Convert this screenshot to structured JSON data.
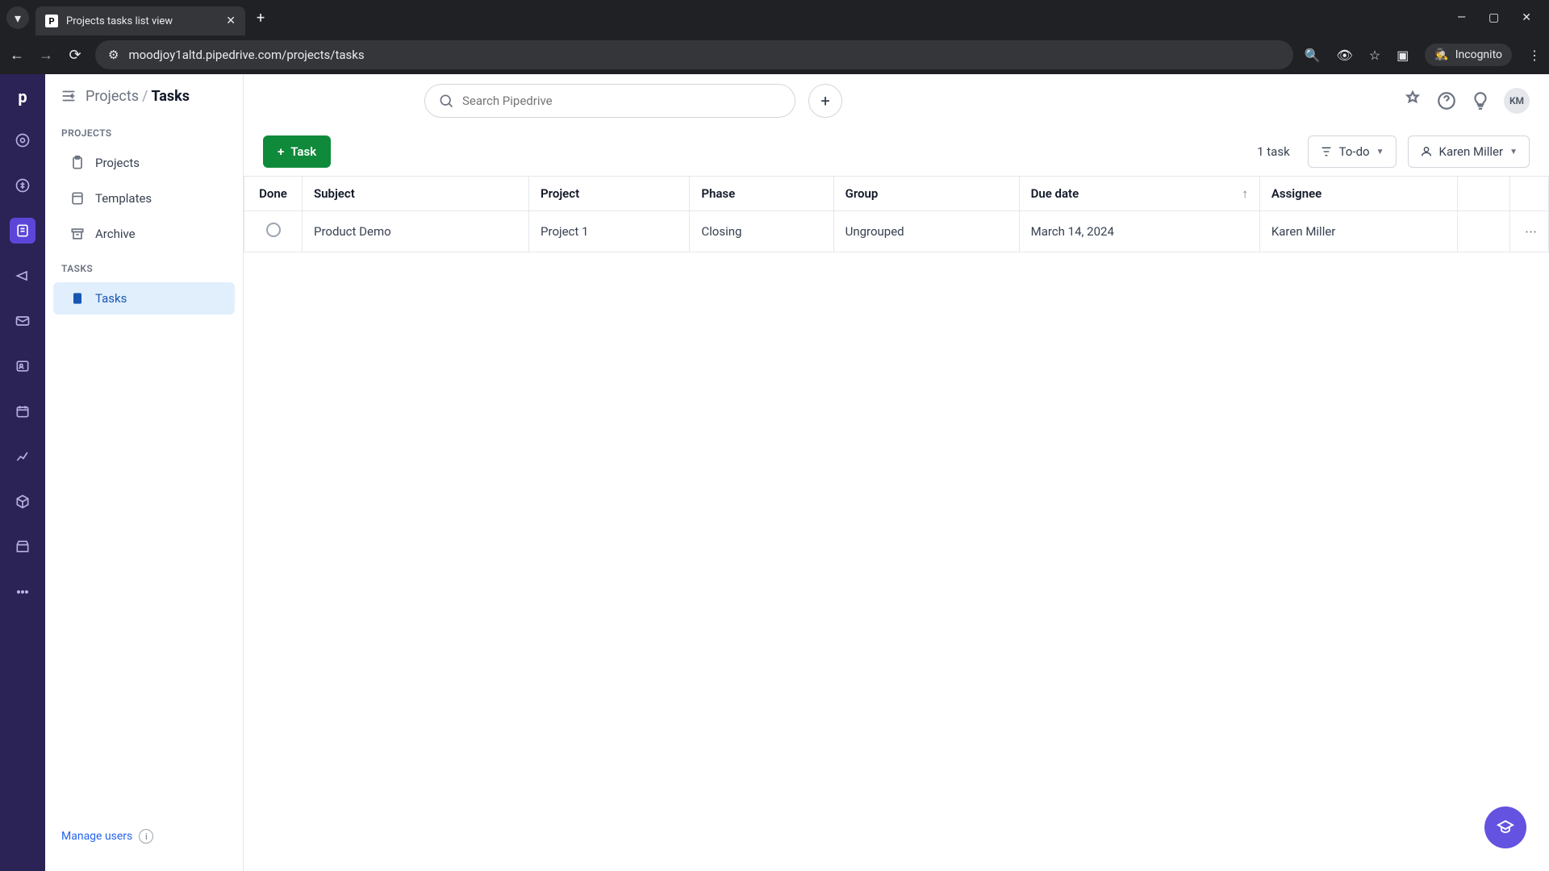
{
  "browser": {
    "tab_title": "Projects tasks list view",
    "url": "moodjoy1altd.pipedrive.com/projects/tasks",
    "incognito_label": "Incognito"
  },
  "header": {
    "breadcrumb_parent": "Projects",
    "breadcrumb_current": "Tasks",
    "search_placeholder": "Search Pipedrive",
    "avatar_initials": "KM"
  },
  "sidebar": {
    "section1_label": "PROJECTS",
    "section2_label": "TASKS",
    "items": {
      "projects": "Projects",
      "templates": "Templates",
      "archive": "Archive",
      "tasks": "Tasks"
    },
    "manage_users": "Manage users"
  },
  "toolbar": {
    "add_task": "Task",
    "count": "1 task",
    "filter_status": "To-do",
    "filter_user": "Karen Miller"
  },
  "columns": {
    "done": "Done",
    "subject": "Subject",
    "project": "Project",
    "phase": "Phase",
    "group": "Group",
    "due": "Due date",
    "assignee": "Assignee"
  },
  "rows": [
    {
      "subject": "Product Demo",
      "project": "Project 1",
      "phase": "Closing",
      "group": "Ungrouped",
      "due": "March 14, 2024",
      "assignee": "Karen Miller"
    }
  ]
}
